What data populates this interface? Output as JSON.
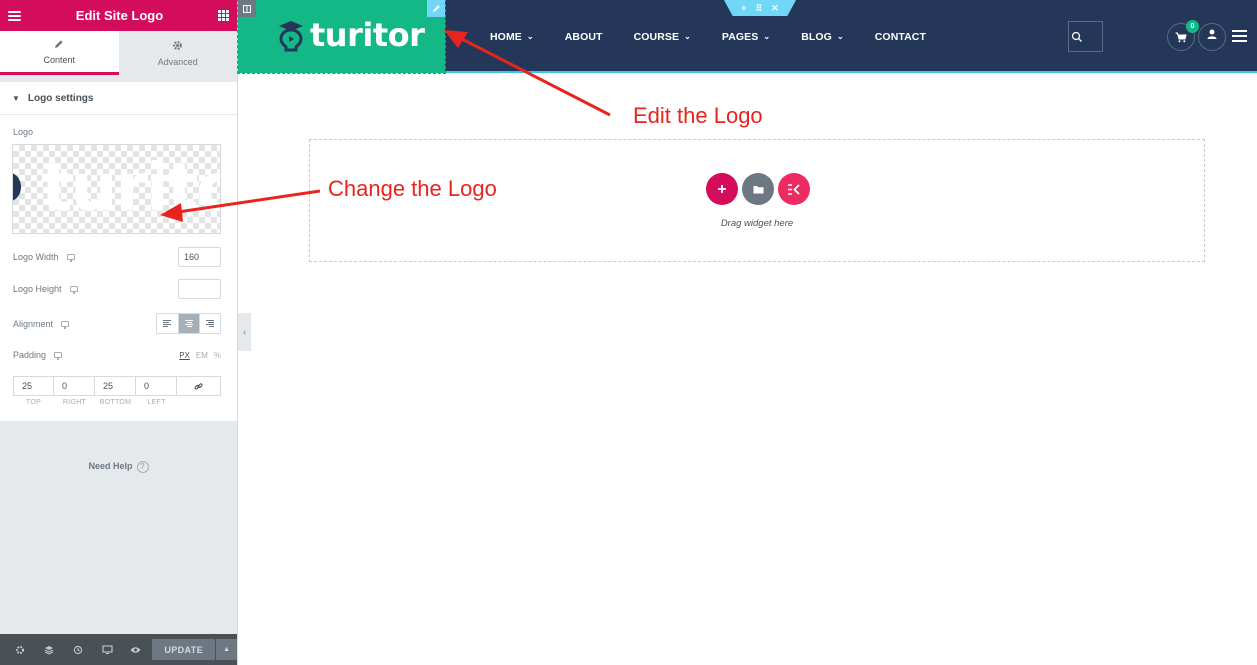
{
  "panel": {
    "title": "Edit Site Logo",
    "tabs": [
      {
        "label": "Content",
        "icon": "pencil-icon"
      },
      {
        "label": "Advanced",
        "icon": "gear-icon"
      }
    ],
    "section_title": "Logo settings",
    "logo_label": "Logo",
    "logo_width_label": "Logo Width",
    "logo_width_value": "160",
    "logo_height_label": "Logo Height",
    "logo_height_value": "",
    "alignment_label": "Alignment",
    "alignment_selected": "center",
    "padding_label": "Padding",
    "units": [
      "PX",
      "EM",
      "%"
    ],
    "selected_unit": "PX",
    "padding": {
      "values": [
        "25",
        "0",
        "25",
        "0"
      ],
      "labels": [
        "TOP",
        "RIGHT",
        "BOTTOM",
        "LEFT"
      ]
    },
    "need_help": "Need Help",
    "update_label": "UPDATE"
  },
  "site": {
    "brand": "turitor",
    "nav": [
      {
        "label": "HOME",
        "dropdown": true
      },
      {
        "label": "ABOUT",
        "dropdown": false
      },
      {
        "label": "COURSE",
        "dropdown": true
      },
      {
        "label": "PAGES",
        "dropdown": true
      },
      {
        "label": "BLOG",
        "dropdown": true
      },
      {
        "label": "CONTACT",
        "dropdown": false
      }
    ],
    "cart_count": "0"
  },
  "editor": {
    "drop_text": "Drag widget here"
  },
  "annotations": {
    "edit_logo": "Edit the Logo",
    "change_logo": "Change the Logo",
    "color": "#e8241f"
  },
  "colors": {
    "accent": "#d30c5c",
    "header_bg": "#243758",
    "logo_bg": "#14b887",
    "handle": "#71d7f7"
  }
}
